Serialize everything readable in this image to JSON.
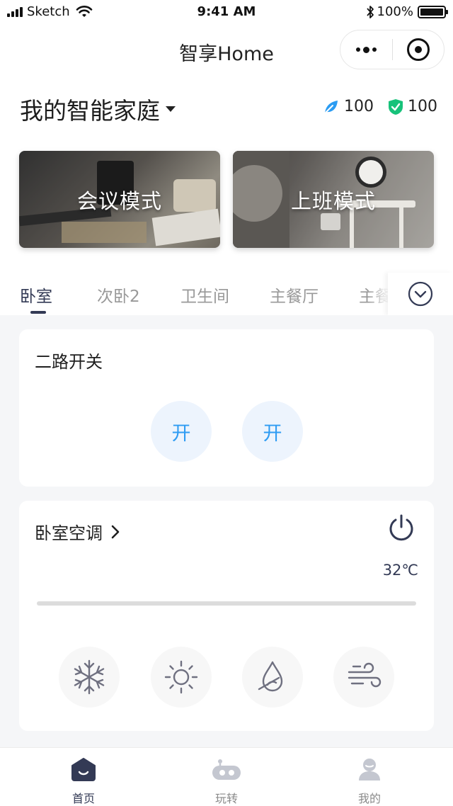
{
  "status_bar": {
    "carrier": "Sketch",
    "time": "9:41 AM",
    "battery": "100%"
  },
  "nav": {
    "title": "智享Home"
  },
  "home": {
    "name": "我的智能家庭",
    "stats": [
      {
        "icon": "leaf-icon",
        "value": "100",
        "color": "#2b9cf2"
      },
      {
        "icon": "shield-check-icon",
        "value": "100",
        "color": "#17c27a"
      }
    ]
  },
  "scenes": [
    {
      "label": "会议模式"
    },
    {
      "label": "上班模式"
    }
  ],
  "rooms": {
    "tabs": [
      "卧室",
      "次卧2",
      "卫生间",
      "主餐厅",
      "主餐"
    ],
    "active_index": 0
  },
  "switch_card": {
    "title": "二路开关",
    "buttons": [
      "开",
      "开"
    ]
  },
  "ac_card": {
    "title": "卧室空调",
    "temperature": "32℃",
    "modes": [
      "snowflake-icon",
      "sun-icon",
      "drop-icon",
      "wind-icon"
    ]
  },
  "tab_bar": {
    "items": [
      {
        "label": "首页",
        "icon": "home-icon",
        "active": true
      },
      {
        "label": "玩转",
        "icon": "robot-icon",
        "active": false
      },
      {
        "label": "我的",
        "icon": "user-icon",
        "active": false
      }
    ]
  },
  "colors": {
    "accent": "#333a55",
    "switch_on": "#2f9cf3",
    "leaf": "#2b9cf2",
    "shield": "#17c27a"
  }
}
